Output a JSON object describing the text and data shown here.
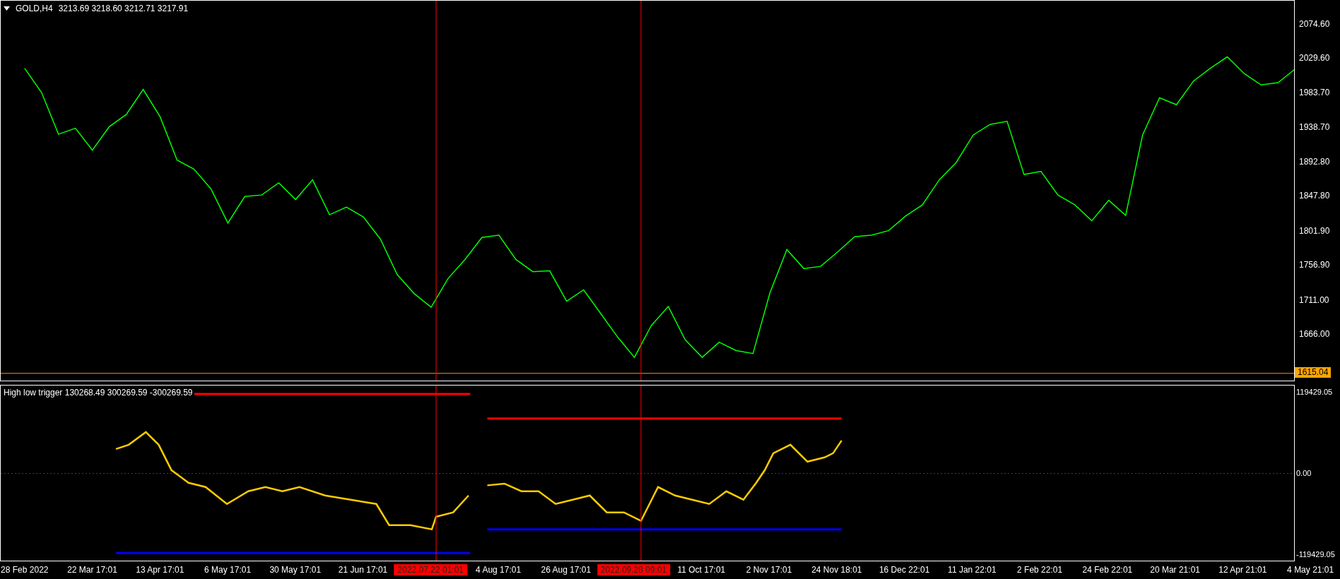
{
  "chart_header": {
    "symbol": "GOLD,H4",
    "ohlc": "3213.69 3218.60 3212.71 3217.91"
  },
  "price_chart": {
    "current_price": "1615.04",
    "chart_data": {
      "type": "line",
      "ylim": [
        1605.4,
        2106.0
      ],
      "ref_lines": [
        {
          "axis": "y",
          "value": 1615.04,
          "color": "#ff9900"
        }
      ],
      "yticks": [
        {
          "value": 2074.6,
          "label": "2074.60"
        },
        {
          "value": 2029.6,
          "label": "2029.60"
        },
        {
          "value": 1983.7,
          "label": "1983.70"
        },
        {
          "value": 1938.7,
          "label": "1938.70"
        },
        {
          "value": 1892.8,
          "label": "1892.80"
        },
        {
          "value": 1847.8,
          "label": "1847.80"
        },
        {
          "value": 1801.9,
          "label": "1801.90"
        },
        {
          "value": 1756.9,
          "label": "1756.90"
        },
        {
          "value": 1711.0,
          "label": "1711.00"
        },
        {
          "value": 1666.0,
          "label": "1666.00"
        }
      ],
      "categories": [
        null,
        null,
        null,
        null,
        null,
        null,
        null,
        null,
        null,
        null,
        null,
        null,
        null,
        null,
        null,
        null,
        null,
        null,
        null,
        null,
        null,
        null,
        null,
        null,
        null,
        null,
        null,
        null,
        null,
        null,
        null,
        null,
        null,
        null,
        null,
        null,
        null,
        null,
        null,
        null,
        null,
        null,
        null,
        null,
        null,
        null,
        null,
        null,
        null,
        null,
        null,
        null,
        null,
        null,
        null,
        null,
        null,
        null,
        null,
        null,
        null,
        null,
        null,
        null,
        null,
        null,
        null,
        null,
        null,
        null,
        null,
        null,
        null,
        null,
        null,
        null,
        null
      ],
      "series": [
        {
          "color": "#00ff00",
          "values": [
            2017,
            1985,
            1930,
            1938,
            1909,
            1940,
            1956,
            1989,
            1953,
            1896,
            1884,
            1858,
            1813,
            1848,
            1850,
            1866,
            1844,
            1870,
            1824,
            1834,
            1821,
            1792,
            1745,
            1720,
            1702,
            1740,
            1765,
            1794,
            1797,
            1765,
            1749,
            1750,
            1710,
            1725,
            1694,
            1663,
            1636,
            1678,
            1703,
            1659,
            1636,
            1656,
            1645,
            1641,
            1721,
            1778,
            1753,
            1756,
            1775,
            1795,
            1797,
            1803,
            1822,
            1837,
            1870,
            1893,
            1929,
            1943,
            1947,
            1877,
            1881,
            1850,
            1837,
            1816,
            1843,
            1823,
            1929,
            1978,
            1969,
            2000,
            2017,
            2032,
            2010,
            1995,
            1998,
            2016,
            null
          ]
        }
      ]
    }
  },
  "indicator": {
    "title": "High low trigger 130268.49 300269.59 -300269.59",
    "axis_labels": [
      "119429.05",
      "0.00",
      "-119429.05"
    ]
  },
  "time_axis": [
    {
      "kind": "date",
      "label": "28 Feb 2022"
    },
    {
      "kind": "date",
      "label": "22 Mar 17:01"
    },
    {
      "kind": "date",
      "label": "13 Apr 17:01"
    },
    {
      "kind": "date",
      "label": "6 May 17:01"
    },
    {
      "kind": "date",
      "label": "30 May 17:01"
    },
    {
      "kind": "date",
      "label": "21 Jun 17:01"
    },
    {
      "kind": "cursor",
      "label": "2022.07.22 01:01"
    },
    {
      "kind": "date",
      "label": "4 Aug 17:01"
    },
    {
      "kind": "date",
      "label": "26 Aug 17:01"
    },
    {
      "kind": "cursor",
      "label": "2022.09.28 09:01"
    },
    {
      "kind": "date",
      "label": "11 Oct 17:01"
    },
    {
      "kind": "date",
      "label": "2 Nov 17:01"
    },
    {
      "kind": "date",
      "label": "24 Nov 18:01"
    },
    {
      "kind": "date",
      "label": "16 Dec 22:01"
    },
    {
      "kind": "date",
      "label": "11 Jan 22:01"
    },
    {
      "kind": "date",
      "label": "2 Feb 22:01"
    },
    {
      "kind": "date",
      "label": "24 Feb 22:01"
    },
    {
      "kind": "date",
      "label": "20 Mar 21:01"
    },
    {
      "kind": "date",
      "label": "12 Apr 21:01"
    },
    {
      "kind": "date",
      "label": "4 May 21:01"
    }
  ]
}
